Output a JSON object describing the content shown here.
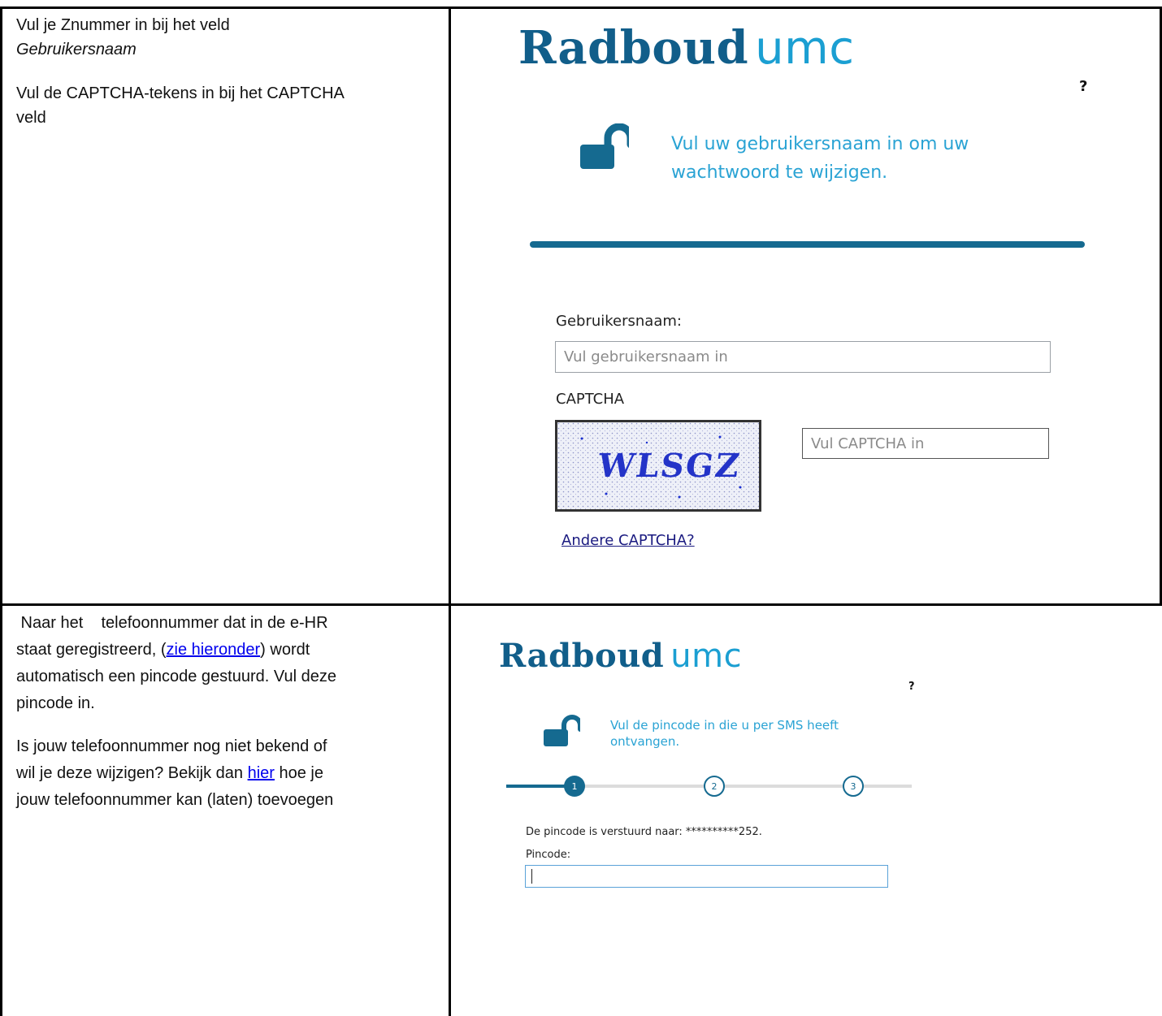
{
  "row1": {
    "instructions": {
      "line1": "Vul je Znummer in bij het veld",
      "line2_italic": "Gebruikersnaam",
      "line3a": "Vul de CAPTCHA-tekens in bij het CAPTCHA",
      "line3b": "veld"
    },
    "screenshot": {
      "logo_main": "Radboud",
      "logo_accent": "umc",
      "help": "?",
      "message_line1": "Vul uw gebruikersnaam in om uw",
      "message_line2": "wachtwoord te wijzigen.",
      "username_label": "Gebruikersnaam:",
      "username_placeholder": "Vul gebruikersnaam in",
      "captcha_label": "CAPTCHA",
      "captcha_text": "WLSGZ",
      "captcha_placeholder": "Vul CAPTCHA in",
      "other_captcha_link": "Andere CAPTCHA?"
    }
  },
  "row2": {
    "instructions": {
      "p1_part1": " Naar het    telefoonnummer dat in de e-HR",
      "p1_part2": "staat geregistreerd, (",
      "p1_link": "zie hieronder",
      "p1_part3": ") wordt",
      "p1_part4": "automatisch een pincode gestuurd. Vul deze",
      "p1_part5": "pincode in.",
      "p2_part1": "Is jouw telefoonnummer nog niet bekend of",
      "p2_part2": "wil je deze wijzigen? Bekijk dan ",
      "p2_link": "hier",
      "p2_part3": " hoe je",
      "p2_part4": "jouw telefoonnummer kan (laten) toevoegen"
    },
    "screenshot": {
      "logo_main": "Radboud",
      "logo_accent": "umc",
      "help": "?",
      "message_line1": "Vul de pincode in die u per SMS heeft",
      "message_line2": "ontvangen.",
      "steps": [
        "1",
        "2",
        "3"
      ],
      "sent_to": "De pincode is verstuurd naar: **********252.",
      "pincode_label": "Pincode:"
    }
  },
  "colors": {
    "brand_dark": "#115e8a",
    "brand_light": "#1b9fd2",
    "bar": "#156a90"
  }
}
